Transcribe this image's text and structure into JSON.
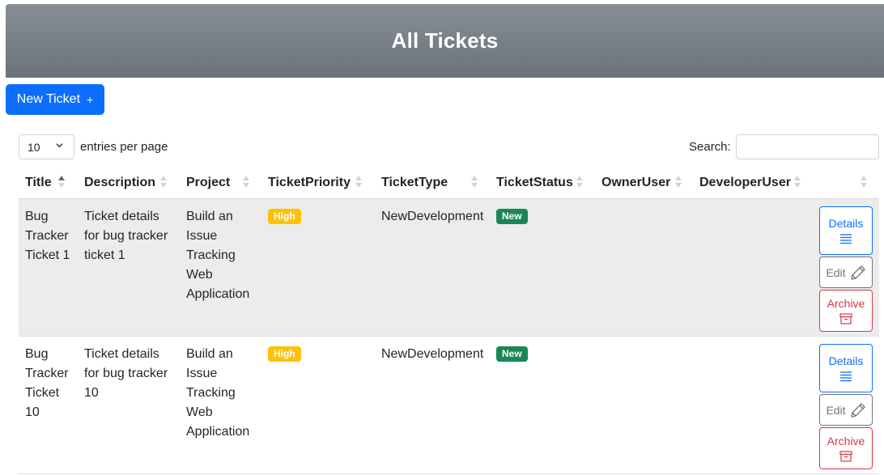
{
  "header": {
    "title": "All Tickets"
  },
  "toolbar": {
    "new_ticket_label": "New Ticket",
    "new_ticket_icon": "plus-icon"
  },
  "controls": {
    "page_length_value": "10",
    "page_length_label": "entries per page",
    "search_label": "Search:",
    "search_value": ""
  },
  "table": {
    "columns": [
      "Title",
      "Description",
      "Project",
      "TicketPriority",
      "TicketType",
      "TicketStatus",
      "OwnerUser",
      "DeveloperUser",
      ""
    ],
    "sorted_column": "Title",
    "sort_direction": "asc",
    "rows": [
      {
        "title": [
          "Bug",
          "Tracker",
          "Ticket 1"
        ],
        "description": [
          "Ticket details",
          "for bug tracker",
          "ticket 1"
        ],
        "project": [
          "Build an",
          "Issue",
          "Tracking",
          "Web",
          "Application"
        ],
        "priority": "High",
        "type": "NewDevelopment",
        "status": "New",
        "owner": "",
        "developer": ""
      },
      {
        "title": [
          "Bug",
          "Tracker",
          "Ticket",
          "10"
        ],
        "description": [
          "Ticket details",
          "for bug tracker",
          "10"
        ],
        "project": [
          "Build an",
          "Issue",
          "Tracking",
          "Web",
          "Application"
        ],
        "priority": "High",
        "type": "NewDevelopment",
        "status": "New",
        "owner": "",
        "developer": ""
      }
    ],
    "actions": {
      "details_label": "Details",
      "edit_label": "Edit",
      "archive_label": "Archive",
      "details_icon": "list-icon",
      "edit_icon": "pencil-icon",
      "archive_icon": "archive-box-icon"
    }
  },
  "colors": {
    "primary": "#0d6efd",
    "danger": "#dc3545",
    "secondary": "#6c757d",
    "warning": "#ffc107",
    "success": "#198754"
  }
}
